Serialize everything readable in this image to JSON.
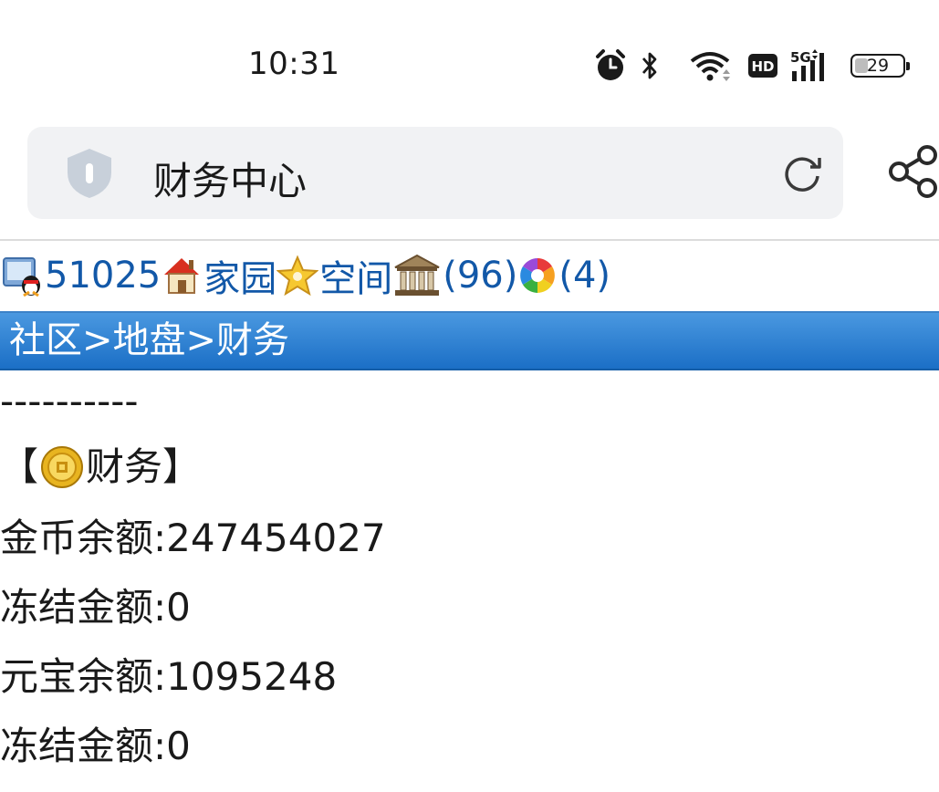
{
  "status_bar": {
    "time": "10:31",
    "battery": "29",
    "battery_level_percent": 29,
    "icons": [
      "alarm-icon",
      "bluetooth-icon",
      "wifi-icon",
      "hd-icon",
      "5g-signal-icon",
      "battery-icon"
    ]
  },
  "address_bar": {
    "title": "财务中心",
    "icons": [
      "shield-icon",
      "reload-icon",
      "share-icon"
    ]
  },
  "nav": {
    "user_id": "51025",
    "home": "家园",
    "space": "空间",
    "bank_count": "(96)",
    "photo_count": "(4)",
    "icons": [
      "qq-user-icon",
      "home-icon",
      "star-icon",
      "bank-icon",
      "photo-icon"
    ]
  },
  "breadcrumb": {
    "item1": "社区",
    "sep1": ">",
    "item2": "地盘",
    "sep2": ">",
    "item3": "财务"
  },
  "content": {
    "dashes": "----------",
    "section_open": "【",
    "section_title": "财务",
    "section_close": "】",
    "gold_balance": "金币余额:247454027",
    "gold_frozen": "冻结金额:0",
    "ingot_balance": "元宝余额:1095248",
    "ingot_frozen": "冻结金额:0"
  },
  "colors": {
    "link": "#1258a8",
    "breadcrumb_bg_top": "#4a98e0",
    "breadcrumb_bg_bottom": "#1b6fc6"
  }
}
